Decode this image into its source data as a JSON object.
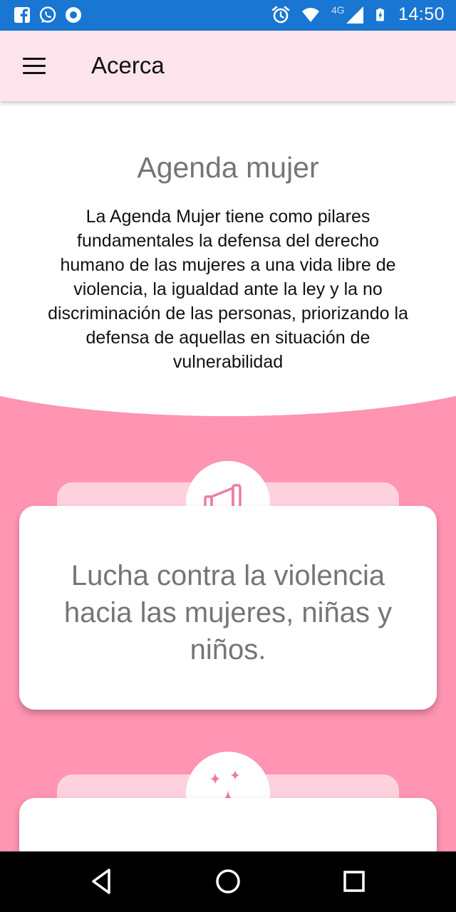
{
  "status_bar": {
    "time": "14:50",
    "network": "4G",
    "left_icons": [
      "facebook-icon",
      "whatsapp-icon",
      "chrome-icon"
    ],
    "right_icons": [
      "alarm-icon",
      "wifi-icon",
      "signal-icon",
      "battery-icon"
    ]
  },
  "app_bar": {
    "title": "Acerca",
    "menu_icon": "hamburger-menu-icon"
  },
  "hero": {
    "title": "Agenda mujer",
    "description": "La Agenda Mujer tiene como pilares fundamentales la defensa del derecho humano de las mujeres a una vida libre de violencia, la igualdad ante la ley y la no discriminación de las personas, priorizando la defensa de aquellas en situación de vulnerabilidad"
  },
  "cards": [
    {
      "icon": "megaphone-icon",
      "text": "Lucha contra la violencia hacia las mujeres, niñas y niños."
    },
    {
      "icon": "sparkles-icon",
      "text": ""
    }
  ],
  "nav_bar": {
    "buttons": [
      "back-icon",
      "home-icon",
      "recents-icon"
    ]
  },
  "colors": {
    "status_bar": "#1976d2",
    "app_bar": "#fde4ec",
    "background": "#ff95b2",
    "card_tab": "#fdd2de",
    "accent_icon": "#ef7d9c"
  }
}
